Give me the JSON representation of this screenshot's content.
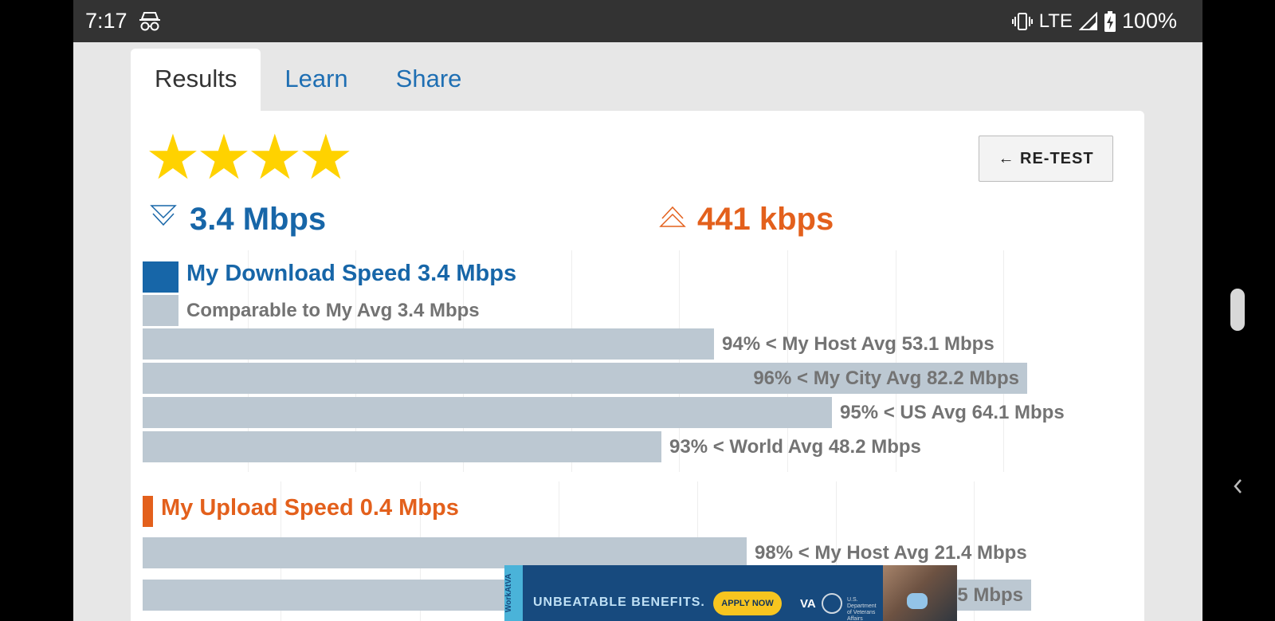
{
  "status_bar": {
    "time": "7:17",
    "network": "LTE",
    "battery": "100%"
  },
  "tabs": [
    {
      "label": "Results",
      "active": true
    },
    {
      "label": "Learn",
      "active": false
    },
    {
      "label": "Share",
      "active": false
    }
  ],
  "rating": {
    "stars": 4,
    "max": 4
  },
  "retest_label": "← RE-TEST",
  "download": {
    "value": "3.4 Mbps",
    "color": "#1766a8"
  },
  "upload": {
    "value": "441 kbps",
    "color": "#e3601c"
  },
  "download_chart": {
    "title": "My Download Speed 3.4 Mbps",
    "comparable": "Comparable to My Avg 3.4 Mbps",
    "bars": [
      {
        "label": "94% < My Host Avg 53.1 Mbps",
        "value": 53.1
      },
      {
        "label": "96% < My City Avg 82.2 Mbps",
        "value": 82.2
      },
      {
        "label": "95% < US Avg 64.1 Mbps",
        "value": 64.1
      },
      {
        "label": "93% < World Avg 48.2 Mbps",
        "value": 48.2
      }
    ]
  },
  "upload_chart": {
    "title": "My Upload Speed 0.4 Mbps",
    "bars": [
      {
        "label": "98% < My Host Avg 21.4 Mbps",
        "value": 21.4
      },
      {
        "label": "Avg 31.5 Mbps",
        "value": 31.5
      }
    ]
  },
  "ad": {
    "side_text": "WorkAtVA",
    "headline": "UNBEATABLE BENEFITS.",
    "button": "APPLY NOW",
    "brand": "VA",
    "dept": "U.S. Department of Veterans Affairs"
  }
}
